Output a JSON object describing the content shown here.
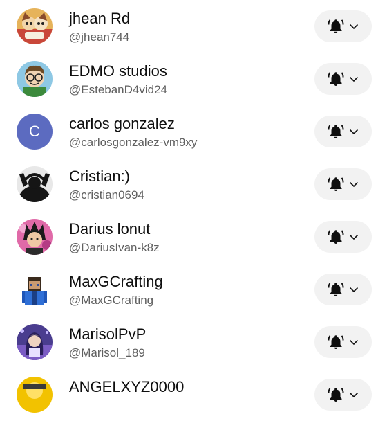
{
  "subscriptions": [
    {
      "name": "jhean Rd",
      "handle": "@jhean744",
      "avatar": {
        "kind": "image",
        "bg": "#e6b35a"
      }
    },
    {
      "name": "EDMO studios",
      "handle": "@EstebanD4vid24",
      "avatar": {
        "kind": "image",
        "bg": "#8ec8e4"
      }
    },
    {
      "name": "carlos gonzalez",
      "handle": "@carlosgonzalez-vm9xy",
      "avatar": {
        "kind": "letter",
        "letter": "C",
        "bg": "#5c6bc0"
      }
    },
    {
      "name": "Cristian:)",
      "handle": "@cristian0694",
      "avatar": {
        "kind": "image",
        "bg": "#e8e8e8"
      }
    },
    {
      "name": "Darius lonut",
      "handle": "@DariusIvan-k8z",
      "avatar": {
        "kind": "image",
        "bg": "#e06aa8"
      }
    },
    {
      "name": "MaxGCrafting",
      "handle": "@MaxGCrafting",
      "avatar": {
        "kind": "image",
        "bg": "#ffffff"
      }
    },
    {
      "name": "MarisolPvP",
      "handle": "@Marisol_189",
      "avatar": {
        "kind": "image",
        "bg": "#4a3d8f"
      }
    },
    {
      "name": "ANGELXYZ0000",
      "handle": "",
      "avatar": {
        "kind": "image",
        "bg": "#f2c200"
      }
    }
  ],
  "notify_button": {
    "icon": "bell-filled-icon",
    "dropdown_icon": "chevron-down-icon"
  },
  "colors": {
    "name_text": "#0f0f0f",
    "handle_text": "#606060",
    "button_bg": "#f2f2f2",
    "icon": "#0f0f0f"
  }
}
